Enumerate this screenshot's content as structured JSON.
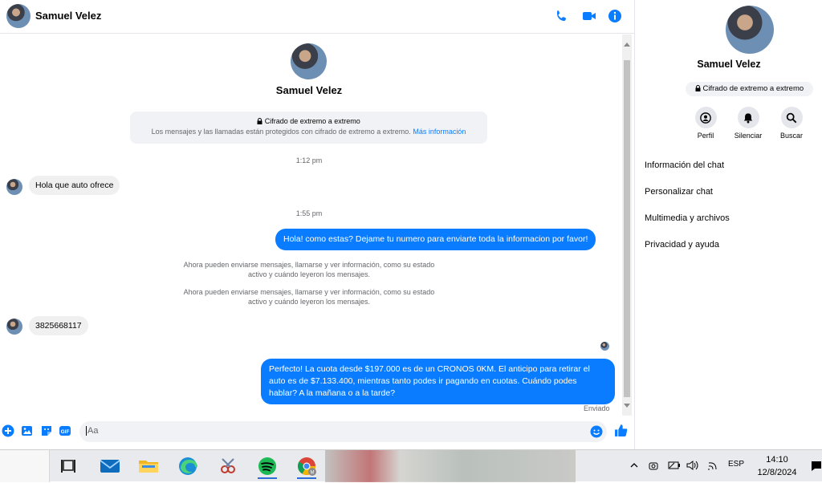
{
  "header": {
    "name": "Samuel Velez"
  },
  "chat": {
    "contact_name": "Samuel Velez",
    "encryption_title": "Cifrado de extremo a extremo",
    "encryption_sub": "Los mensajes y las llamadas están protegidos con cifrado de extremo a extremo.",
    "encryption_link": "Más información",
    "time1": "1:12 pm",
    "msg_in_1": "Hola que auto ofrece",
    "time2": "1:55 pm",
    "msg_out_1": "Hola! como estas? Dejame tu numero para enviarte toda la informacion por favor!",
    "system_1": "Ahora pueden enviarse mensajes, llamarse y ver información, como su estado activo y cuándo leyeron los mensajes.",
    "system_2": "Ahora pueden enviarse mensajes, llamarse y ver información, como su estado activo y cuándo leyeron los mensajes.",
    "msg_in_2": "3825668117",
    "msg_out_2": "Perfecto! La cuota desde $197.000 es de un CRONOS 0KM. El anticipo para retirar el auto es de $7.133.400, mientras tanto podes ir pagando en cuotas. Cuándo podes hablar? A la mañana o a la tarde?",
    "status": "Enviado"
  },
  "composer": {
    "placeholder": "Aa"
  },
  "panel": {
    "name": "Samuel Velez",
    "badge": "Cifrado de extremo a extremo",
    "buttons": [
      {
        "label": "Perfil"
      },
      {
        "label": "Silenciar"
      },
      {
        "label": "Buscar"
      }
    ],
    "menu": [
      {
        "label": "Información del chat"
      },
      {
        "label": "Personalizar chat"
      },
      {
        "label": "Multimedia y archivos"
      },
      {
        "label": "Privacidad y ayuda"
      }
    ]
  },
  "taskbar": {
    "language": "ESP",
    "time": "14:10",
    "date": "12/8/2024"
  },
  "colors": {
    "accent": "#0a7cff",
    "bubble_in": "#f0f0f0"
  }
}
